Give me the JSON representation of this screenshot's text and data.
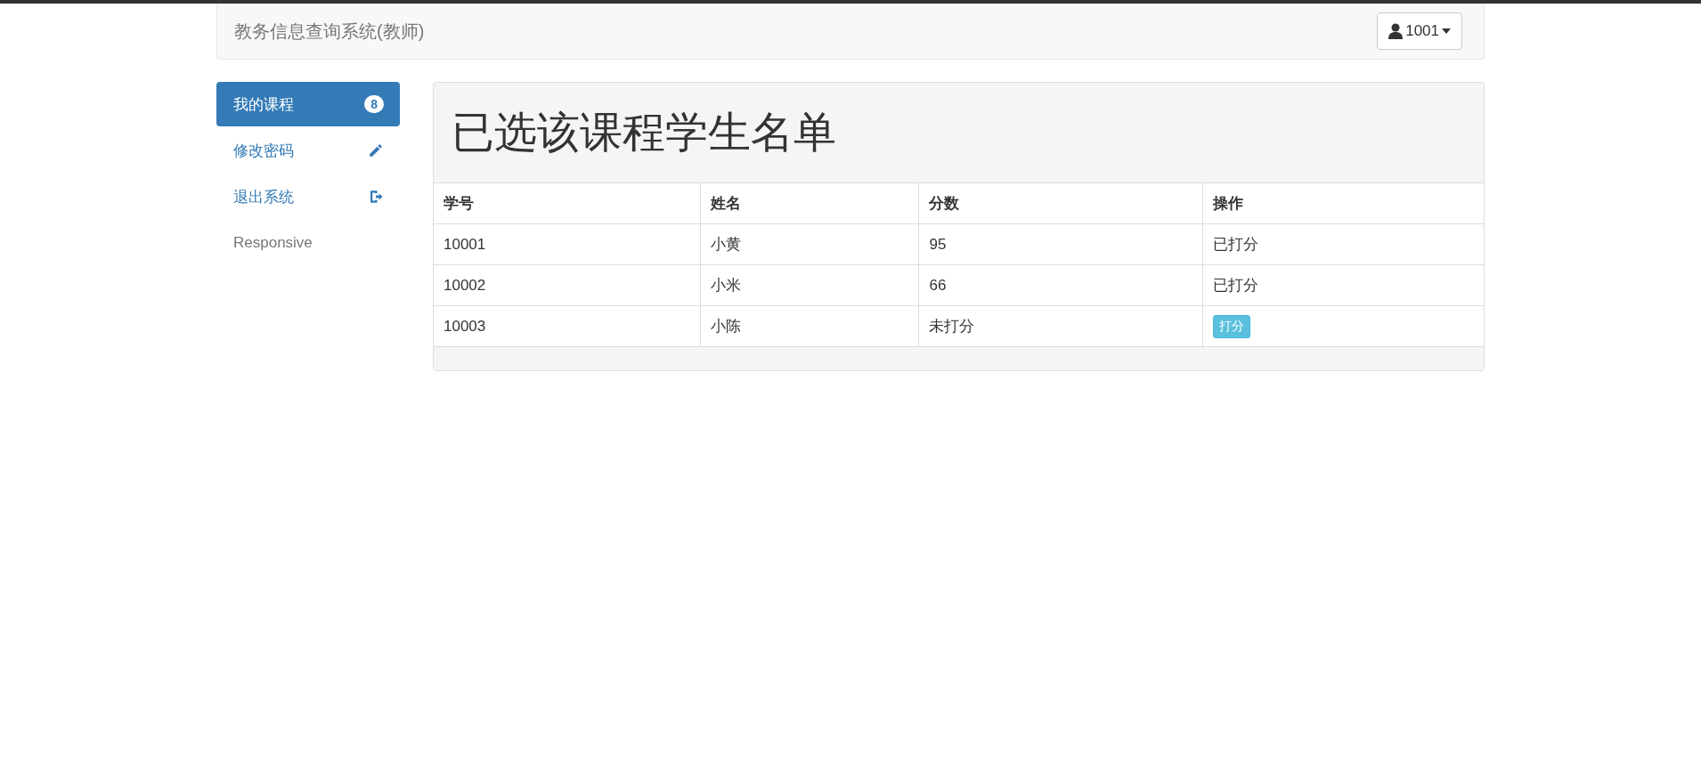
{
  "navbar": {
    "brand": "教务信息查询系统(教师)",
    "user_menu": "1001"
  },
  "sidebar": {
    "items": [
      {
        "label": "我的课程",
        "selected": true,
        "badge": "8",
        "kind": "badge"
      },
      {
        "label": "修改密码",
        "selected": false,
        "kind": "edit"
      },
      {
        "label": "退出系统",
        "selected": false,
        "kind": "exit"
      },
      {
        "label": "Responsive",
        "selected": false,
        "kind": "muted"
      }
    ]
  },
  "panel": {
    "title": "已选该课程学生名单",
    "table": {
      "columns": [
        "学号",
        "姓名",
        "分数",
        "操作"
      ],
      "rows": [
        {
          "cells": [
            "10001",
            "小黄",
            "95"
          ],
          "action": {
            "kind": "text",
            "label": "已打分"
          }
        },
        {
          "cells": [
            "10002",
            "小米",
            "66"
          ],
          "action": {
            "kind": "text",
            "label": "已打分"
          }
        },
        {
          "cells": [
            "10003",
            "小陈",
            "未打分"
          ],
          "action": {
            "kind": "button",
            "label": "打分"
          }
        }
      ]
    }
  }
}
